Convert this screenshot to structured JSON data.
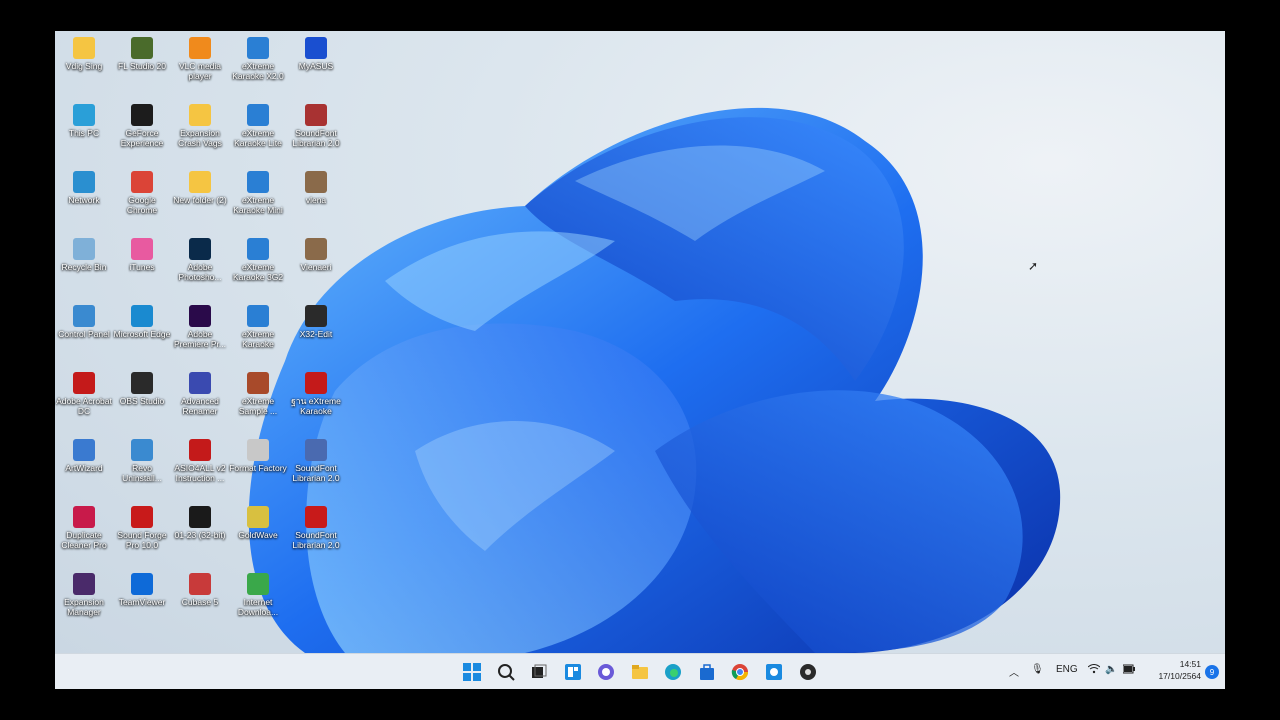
{
  "desktop": {
    "icons": [
      [
        "Vdig Sing",
        "#f5c542",
        "folder-icon"
      ],
      [
        "FL Studio 20",
        "#4a6b2b",
        "fl-studio-icon"
      ],
      [
        "VLC media player",
        "#f08a1c",
        "vlc-icon"
      ],
      [
        "eXtreme Karaoke X2.0",
        "#2a7fd4",
        "karaoke-icon"
      ],
      [
        "MyASUS",
        "#1a4fd0",
        "myasus-icon"
      ],
      [
        "This PC",
        "#2a9fd8",
        "computer-icon"
      ],
      [
        "GeForce Experience",
        "#1c1c1c",
        "geforce-icon"
      ],
      [
        "Expansion Crash Vags",
        "#f5c542",
        "folder-icon"
      ],
      [
        "eXtreme Karaoke Lite",
        "#2a7fd4",
        "karaoke-icon"
      ],
      [
        "SoundFont Librarian 2.0",
        "#a83232",
        "archive-icon"
      ],
      [
        "Network",
        "#2a8fd0",
        "network-icon"
      ],
      [
        "Google Chrome",
        "#db4437",
        "chrome-icon"
      ],
      [
        "New folder (2)",
        "#f5c542",
        "folder-icon"
      ],
      [
        "eXtreme Karaoke Mini",
        "#2a7fd4",
        "karaoke-icon"
      ],
      [
        "vlena",
        "#8a6a4a",
        "app-icon"
      ],
      [
        "Recycle Bin",
        "#7fb0d8",
        "recycle-bin-icon"
      ],
      [
        "iTunes",
        "#e85aa0",
        "itunes-icon"
      ],
      [
        "Adobe Photosho...",
        "#0a2a4a",
        "photoshop-icon"
      ],
      [
        "eXtreme Karaoke 3G2",
        "#2a7fd4",
        "karaoke-icon"
      ],
      [
        "Vienaeri",
        "#8a6a4a",
        "app-icon"
      ],
      [
        "Control Panel",
        "#3a8ad0",
        "control-panel-icon"
      ],
      [
        "Microsoft Edge",
        "#1a8ad0",
        "edge-icon"
      ],
      [
        "Adobe Premiere Pr...",
        "#2a0a4a",
        "premiere-icon"
      ],
      [
        "eXtreme Karaoke",
        "#2a7fd4",
        "karaoke-icon"
      ],
      [
        "X32-Edit",
        "#2a2a2a",
        "x32-edit-icon"
      ],
      [
        "Adobe Acrobat DC",
        "#c41a1a",
        "acrobat-icon"
      ],
      [
        "OBS Studio",
        "#2a2a2a",
        "obs-icon"
      ],
      [
        "Advanced Renamer",
        "#3a4ab0",
        "renamer-icon"
      ],
      [
        "eXtreme Sample ...",
        "#a84a2a",
        "sample-icon"
      ],
      [
        "ฐาน eXtreme Karaoke",
        "#c41a1a",
        "pdf-icon"
      ],
      [
        "ArtWizard",
        "#3a7ad0",
        "artwizard-icon"
      ],
      [
        "Revo Uninstall...",
        "#3a8ad0",
        "revo-icon"
      ],
      [
        "ASIO4ALL v2 Instruction ...",
        "#c41a1a",
        "pdf-icon"
      ],
      [
        "Format Factory",
        "#c8c8c8",
        "format-factory-icon"
      ],
      [
        "SoundFont Librarian 2.0",
        "#4a6ab0",
        "soundfont-icon"
      ],
      [
        "Duplicate Cleaner Pro",
        "#c81a4a",
        "duplicate-cleaner-icon"
      ],
      [
        "Sound Forge Pro 10.0",
        "#c81a1a",
        "sound-forge-icon"
      ],
      [
        "01-23 (32-bit)",
        "#1a1a1a",
        "app-icon"
      ],
      [
        "GoldWave",
        "#d8c040",
        "goldwave-icon"
      ],
      [
        "SoundFont Librarian 2.0",
        "#c81a1a",
        "soundfont-icon"
      ],
      [
        "Expansion Manager",
        "#4a2a6a",
        "expansion-manager-icon"
      ],
      [
        "TeamViewer",
        "#0e6ad8",
        "teamviewer-icon"
      ],
      [
        "Cubase 5",
        "#c83a3a",
        "cubase-icon"
      ],
      [
        "Internet Downloa...",
        "#3aa84a",
        "idm-icon"
      ]
    ]
  },
  "taskbar": {
    "lang": "ENG",
    "time": "14:51",
    "date": "17/10/2564",
    "notification_count": "9"
  }
}
